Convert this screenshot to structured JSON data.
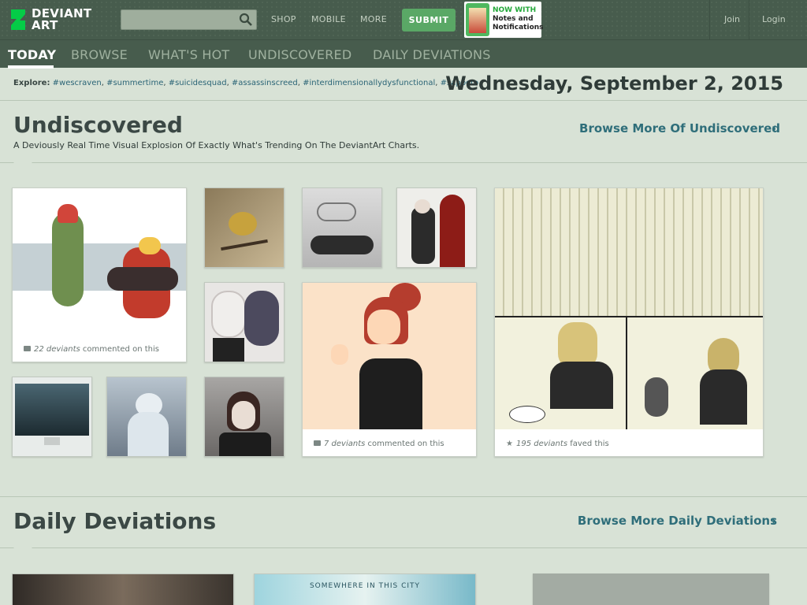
{
  "header": {
    "logo_line1": "DEVIANT",
    "logo_line2": "ART",
    "search_placeholder": "",
    "nav": [
      "SHOP",
      "MOBILE",
      "MORE"
    ],
    "submit_label": "SUBMIT",
    "promo_line1": "NOW WITH",
    "promo_line2": "Notes and",
    "promo_line3": "Notifications",
    "join_label": "Join",
    "login_label": "Login"
  },
  "tabs": [
    "TODAY",
    "BROWSE",
    "WHAT'S HOT",
    "UNDISCOVERED",
    "DAILY DEVIATIONS"
  ],
  "explore": {
    "label": "Explore:",
    "tags": [
      "#wescraven",
      "#summertime",
      "#suicidesquad",
      "#assassinscreed",
      "#interdimensionallydysfunctional",
      "#sapporo"
    ]
  },
  "date": "Wednesday, September 2, 2015",
  "undiscovered": {
    "title": "Undiscovered",
    "subtitle": "A Deviously Real Time Visual Explosion Of Exactly What's Trending On The DeviantArt Charts.",
    "browse_more": "Browse More Of Undiscovered",
    "card1_count": "22 deviants",
    "card1_suffix": " commented on this",
    "card2_count": "7 deviants",
    "card2_suffix": " commented on this",
    "card3_count": "195 deviants",
    "card3_suffix": " faved this"
  },
  "daily": {
    "title": "Daily Deviations",
    "browse_more": "Browse More Daily Deviations",
    "thumb2_caption": "SOMEWHERE IN THIS CITY"
  },
  "colors": {
    "bg": "#d8e2d6",
    "topbar": "#475c4d",
    "submit": "#5aa866",
    "link": "#2f6e7a"
  }
}
